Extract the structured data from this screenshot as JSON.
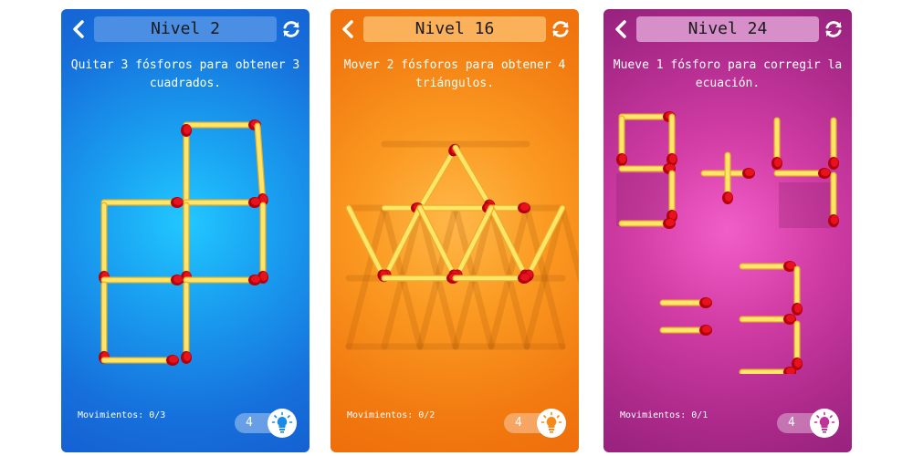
{
  "icons": {
    "back": "chevron-left-icon",
    "reset": "refresh-icon",
    "hint": "lightbulb-icon"
  },
  "screens": [
    {
      "title": "Nivel 2",
      "instruction": "Quitar 3 fósforos para obtener 3 cuadrados.",
      "moves": "Movimientos: 0/3",
      "hints": "4",
      "color": "#1a8ae8"
    },
    {
      "title": "Nivel 16",
      "instruction": "Mover 2 fósforos para obtener 4 triángulos.",
      "moves": "Movimientos: 0/2",
      "hints": "4",
      "color": "#f58a18"
    },
    {
      "title": "Nivel 24",
      "instruction": "Mueve 1 fósforo para corregir la ecuación.",
      "moves": "Movimientos: 0/1",
      "hints": "4",
      "color": "#c03398"
    }
  ]
}
